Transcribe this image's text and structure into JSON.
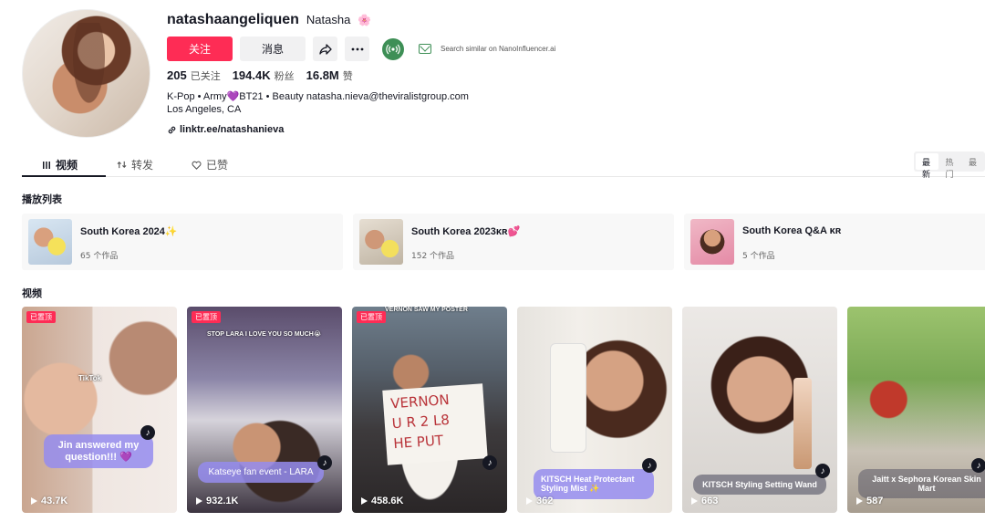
{
  "profile": {
    "username": "natashaangeliquen",
    "nickname": "Natasha",
    "nickname_emoji": "🌸",
    "follow_label": "关注",
    "message_label": "消息",
    "search_similar": "Search similar on NanoInfluencer.ai",
    "stats": [
      {
        "num": "205",
        "label": "已关注"
      },
      {
        "num": "194.4K",
        "label": "粉丝"
      },
      {
        "num": "16.8M",
        "label": "赞"
      }
    ],
    "bio_line1_a": "K-Pop • Army",
    "bio_heart": "💜",
    "bio_line1_b": "BT21 • Beauty natasha.nieva@theviralistgroup.com",
    "bio_line2": "Los Angeles, CA",
    "link": "linktr.ee/natashanieva"
  },
  "tabs": [
    {
      "label": "视频",
      "icon": "grid-icon"
    },
    {
      "label": "转发",
      "icon": "repost-icon"
    },
    {
      "label": "已赞",
      "icon": "heart-outline-icon"
    }
  ],
  "sort": [
    "最新",
    "热门",
    "最"
  ],
  "sections": {
    "playlists": "播放列表",
    "videos": "视频"
  },
  "playlists": [
    {
      "title": "South Korea 2024",
      "emoji": "✨",
      "count": "65 个作品"
    },
    {
      "title": "South Korea 2023",
      "emoji": "ᴋʀ💕",
      "count": "152 个作品"
    },
    {
      "title": "South Korea Q&A",
      "emoji": "ᴋʀ",
      "count": "5 个作品"
    }
  ],
  "videos": [
    {
      "pinned": "已置顶",
      "caption": "Jin answered my question!!! 💜",
      "views": "43.7K",
      "overlay": "TikTok"
    },
    {
      "pinned": "已置顶",
      "caption": "Katseye fan event - LARA",
      "views": "932.1K",
      "overlay": "STOP LARA I LOVE YOU SO MUCH😭"
    },
    {
      "pinned": "已置顶",
      "caption": "",
      "views": "458.6K",
      "overlay": "VERNON SAW MY POSTER"
    },
    {
      "pinned": "",
      "caption": "KITSCH Heat Protectant Styling Mist ✨",
      "views": "362",
      "overlay": ""
    },
    {
      "pinned": "",
      "caption": "KITSCH Styling Setting Wand",
      "views": "663",
      "overlay": ""
    },
    {
      "pinned": "",
      "caption": "Jaitt x Sephora Korean Skin Mart",
      "views": "587",
      "overlay": ""
    }
  ],
  "colors": {
    "accent": "#fe2c55",
    "caption_bg": "#958cee",
    "brand_green": "#3e8f56"
  }
}
